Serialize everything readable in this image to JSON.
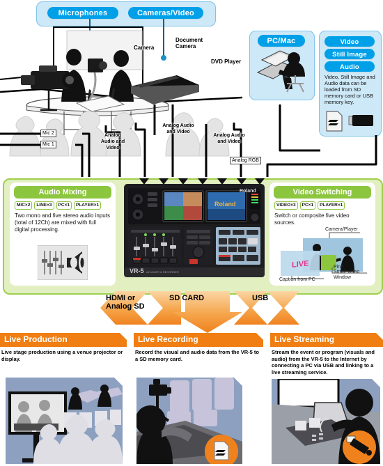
{
  "top_sources": {
    "group_box": {
      "badges": [
        "Microphones",
        "Cameras/Video"
      ]
    },
    "scene_labels": [
      "Camera",
      "Document Camera",
      "DVD Player"
    ],
    "pcmac": {
      "label": "PC/Mac"
    },
    "media": {
      "badges": [
        "Video",
        "Still Image",
        "Audio"
      ],
      "description": "Video, Still Image and Audio data can be loaded from SD memory card or USB memory key.",
      "icons": [
        "sd-card-icon",
        "usb-key-icon"
      ]
    }
  },
  "wire_labels": {
    "mic2": "Mic 2",
    "mic1": "Mic 1",
    "analog_av_1": "Analog Audio and Video",
    "analog_av_2": "Analog Audio and Video",
    "analog_av_3": "Analog Audio and Video",
    "analog_rgb": "Analog RGB"
  },
  "device": {
    "brand": "Roland",
    "model": "VR-5",
    "model_sub": "AV MIXER & RECORDER"
  },
  "features": {
    "audio": {
      "title": "Audio Mixing",
      "chips": [
        "MIC×2",
        "LINE×3",
        "PC×1",
        "PLAYER×1"
      ],
      "text": "Two mono and five stereo audio inputs (total of 12Ch) are mixed with full digital processing.",
      "illustration": "audio-faders-speaker-icon"
    },
    "video": {
      "title": "Video Switching",
      "chips": [
        "VIDEO×3",
        "PC×1",
        "PLAYER×1"
      ],
      "text": "Switch or composite five video sources.",
      "illustration_labels": {
        "camera_player": "Camera/Player",
        "pinp": "PinP",
        "pinp_sub": "Small Video Window",
        "caption": "Caption from PC",
        "live": "LIVE"
      }
    }
  },
  "arrows": [
    {
      "label": "HDMI or\nAnalog SD",
      "line1": "HDMI or",
      "line2": "Analog SD",
      "color": "#F0821E"
    },
    {
      "label": "SD CARD",
      "line1": "SD CARD",
      "line2": "",
      "color": "#F0821E"
    },
    {
      "label": "USB",
      "line1": "USB",
      "line2": "",
      "color": "#F0821E"
    }
  ],
  "results": [
    {
      "title": "Live Production",
      "text": "Live stage production using a venue projector or display.",
      "badge": null
    },
    {
      "title": "Live Recording",
      "text": "Record the visual and audio data from the VR-5 to a SD memory card.",
      "badge": "sd-card-icon"
    },
    {
      "title": "Live Streaming",
      "text": "Stream the event or program (visuals and audio) from the VR-5 to the Internet by connecting a PC via USB and linking to a live streaming service.",
      "badge": "usb-icon"
    }
  ],
  "colors": {
    "badge_blue": "#00A0E9",
    "panel_blue": "#CDE8F7",
    "green_panel": "#E2EFC0",
    "green_header": "#8CC63F",
    "orange": "#F0821E"
  }
}
